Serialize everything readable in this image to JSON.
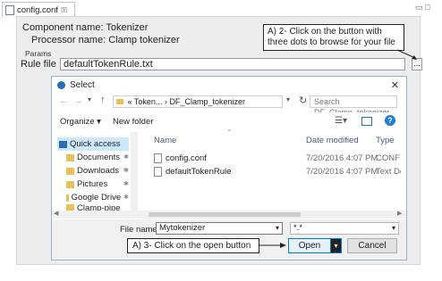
{
  "editor": {
    "tab_title": "config.conf",
    "tab_close": "☒",
    "component_label": "Component name:",
    "component_value": "Tokenizer",
    "processor_label": "Processor name:",
    "processor_value": "Clamp tokenizer",
    "params_label": "Params",
    "rule_label": "Rule file",
    "rule_value": "defaultTokenRule.txt",
    "dots": "...",
    "window_controls": "▭ □"
  },
  "callouts": {
    "browse": "A) 2- Click on the button with three dots to browse for your file",
    "open": "A) 3- Click on the open button"
  },
  "dialog": {
    "title": "Select",
    "close": "✕",
    "breadcrumb": [
      "«",
      "Token...",
      "›",
      "DF_Clamp_tokenizer"
    ],
    "search_placeholder": "Search DF_Clamp_tokenizer",
    "organize": "Organize ▾",
    "new_folder": "New folder",
    "nav_items": [
      {
        "label": "Quick access",
        "icon": "star-icon",
        "selected": true
      },
      {
        "label": "Documents",
        "icon": "documents-icon",
        "pin": "✱"
      },
      {
        "label": "Downloads",
        "icon": "downloads-icon",
        "pin": "✱"
      },
      {
        "label": "Pictures",
        "icon": "pictures-icon",
        "pin": "✱"
      },
      {
        "label": "Google Drive",
        "icon": "drive-icon",
        "pin": "✱"
      },
      {
        "label": "Clamp-pipe",
        "icon": "folder-icon"
      }
    ],
    "columns": {
      "name": "Name",
      "date": "Date modified",
      "type": "Type"
    },
    "files": [
      {
        "name": "config.conf",
        "date": "7/20/2016 4:07 PM",
        "type": "CONF File"
      },
      {
        "name": "defaultTokenRule",
        "date": "7/20/2016 4:07 PM",
        "type": "Text Docu"
      }
    ],
    "filename_label": "File name:",
    "filename_value": "Mytokenizer",
    "filter_value": "*.*",
    "open_label": "Open",
    "cancel_label": "Cancel"
  },
  "colors": {
    "accent": "#0078d7",
    "folder": "#e8c15a",
    "selected": "#cce8ff"
  }
}
